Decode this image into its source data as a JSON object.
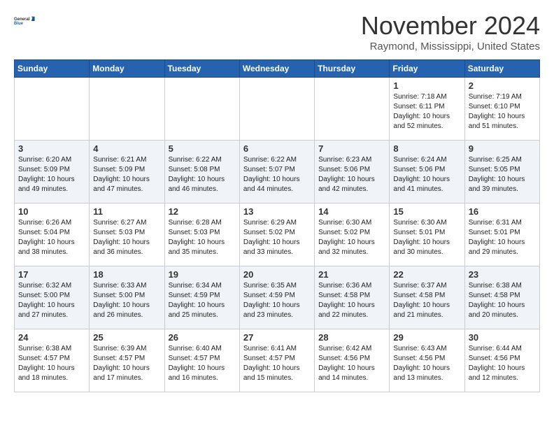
{
  "logo": {
    "line1": "General",
    "line2": "Blue"
  },
  "title": "November 2024",
  "location": "Raymond, Mississippi, United States",
  "days_header": [
    "Sunday",
    "Monday",
    "Tuesday",
    "Wednesday",
    "Thursday",
    "Friday",
    "Saturday"
  ],
  "weeks": [
    [
      {
        "day": "",
        "info": ""
      },
      {
        "day": "",
        "info": ""
      },
      {
        "day": "",
        "info": ""
      },
      {
        "day": "",
        "info": ""
      },
      {
        "day": "",
        "info": ""
      },
      {
        "day": "1",
        "info": "Sunrise: 7:18 AM\nSunset: 6:11 PM\nDaylight: 10 hours\nand 52 minutes."
      },
      {
        "day": "2",
        "info": "Sunrise: 7:19 AM\nSunset: 6:10 PM\nDaylight: 10 hours\nand 51 minutes."
      }
    ],
    [
      {
        "day": "3",
        "info": "Sunrise: 6:20 AM\nSunset: 5:09 PM\nDaylight: 10 hours\nand 49 minutes."
      },
      {
        "day": "4",
        "info": "Sunrise: 6:21 AM\nSunset: 5:09 PM\nDaylight: 10 hours\nand 47 minutes."
      },
      {
        "day": "5",
        "info": "Sunrise: 6:22 AM\nSunset: 5:08 PM\nDaylight: 10 hours\nand 46 minutes."
      },
      {
        "day": "6",
        "info": "Sunrise: 6:22 AM\nSunset: 5:07 PM\nDaylight: 10 hours\nand 44 minutes."
      },
      {
        "day": "7",
        "info": "Sunrise: 6:23 AM\nSunset: 5:06 PM\nDaylight: 10 hours\nand 42 minutes."
      },
      {
        "day": "8",
        "info": "Sunrise: 6:24 AM\nSunset: 5:06 PM\nDaylight: 10 hours\nand 41 minutes."
      },
      {
        "day": "9",
        "info": "Sunrise: 6:25 AM\nSunset: 5:05 PM\nDaylight: 10 hours\nand 39 minutes."
      }
    ],
    [
      {
        "day": "10",
        "info": "Sunrise: 6:26 AM\nSunset: 5:04 PM\nDaylight: 10 hours\nand 38 minutes."
      },
      {
        "day": "11",
        "info": "Sunrise: 6:27 AM\nSunset: 5:03 PM\nDaylight: 10 hours\nand 36 minutes."
      },
      {
        "day": "12",
        "info": "Sunrise: 6:28 AM\nSunset: 5:03 PM\nDaylight: 10 hours\nand 35 minutes."
      },
      {
        "day": "13",
        "info": "Sunrise: 6:29 AM\nSunset: 5:02 PM\nDaylight: 10 hours\nand 33 minutes."
      },
      {
        "day": "14",
        "info": "Sunrise: 6:30 AM\nSunset: 5:02 PM\nDaylight: 10 hours\nand 32 minutes."
      },
      {
        "day": "15",
        "info": "Sunrise: 6:30 AM\nSunset: 5:01 PM\nDaylight: 10 hours\nand 30 minutes."
      },
      {
        "day": "16",
        "info": "Sunrise: 6:31 AM\nSunset: 5:01 PM\nDaylight: 10 hours\nand 29 minutes."
      }
    ],
    [
      {
        "day": "17",
        "info": "Sunrise: 6:32 AM\nSunset: 5:00 PM\nDaylight: 10 hours\nand 27 minutes."
      },
      {
        "day": "18",
        "info": "Sunrise: 6:33 AM\nSunset: 5:00 PM\nDaylight: 10 hours\nand 26 minutes."
      },
      {
        "day": "19",
        "info": "Sunrise: 6:34 AM\nSunset: 4:59 PM\nDaylight: 10 hours\nand 25 minutes."
      },
      {
        "day": "20",
        "info": "Sunrise: 6:35 AM\nSunset: 4:59 PM\nDaylight: 10 hours\nand 23 minutes."
      },
      {
        "day": "21",
        "info": "Sunrise: 6:36 AM\nSunset: 4:58 PM\nDaylight: 10 hours\nand 22 minutes."
      },
      {
        "day": "22",
        "info": "Sunrise: 6:37 AM\nSunset: 4:58 PM\nDaylight: 10 hours\nand 21 minutes."
      },
      {
        "day": "23",
        "info": "Sunrise: 6:38 AM\nSunset: 4:58 PM\nDaylight: 10 hours\nand 20 minutes."
      }
    ],
    [
      {
        "day": "24",
        "info": "Sunrise: 6:38 AM\nSunset: 4:57 PM\nDaylight: 10 hours\nand 18 minutes."
      },
      {
        "day": "25",
        "info": "Sunrise: 6:39 AM\nSunset: 4:57 PM\nDaylight: 10 hours\nand 17 minutes."
      },
      {
        "day": "26",
        "info": "Sunrise: 6:40 AM\nSunset: 4:57 PM\nDaylight: 10 hours\nand 16 minutes."
      },
      {
        "day": "27",
        "info": "Sunrise: 6:41 AM\nSunset: 4:57 PM\nDaylight: 10 hours\nand 15 minutes."
      },
      {
        "day": "28",
        "info": "Sunrise: 6:42 AM\nSunset: 4:56 PM\nDaylight: 10 hours\nand 14 minutes."
      },
      {
        "day": "29",
        "info": "Sunrise: 6:43 AM\nSunset: 4:56 PM\nDaylight: 10 hours\nand 13 minutes."
      },
      {
        "day": "30",
        "info": "Sunrise: 6:44 AM\nSunset: 4:56 PM\nDaylight: 10 hours\nand 12 minutes."
      }
    ]
  ]
}
